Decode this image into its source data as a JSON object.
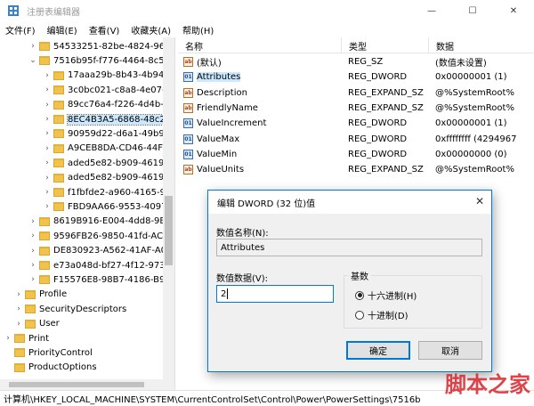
{
  "window": {
    "title": "注册表编辑器",
    "controls": [
      "—",
      "☐",
      "✕"
    ]
  },
  "menu": [
    "文件(F)",
    "编辑(E)",
    "查看(V)",
    "收藏夹(A)",
    "帮助(H)"
  ],
  "tree": [
    {
      "label": "54533251-82be-4824-96c",
      "indent": 32,
      "chevron": "›"
    },
    {
      "label": "7516b95f-f776-4464-8c53",
      "indent": 32,
      "chevron": "⌄"
    },
    {
      "label": "17aaa29b-8b43-4b94",
      "indent": 48,
      "chevron": "›"
    },
    {
      "label": "3c0bc021-c8a8-4e07-a",
      "indent": 48,
      "chevron": "›"
    },
    {
      "label": "89cc76a4-f226-4d4b-a",
      "indent": 48,
      "chevron": "›"
    },
    {
      "label": "8EC4B3A5-6868-48c2-",
      "indent": 48,
      "chevron": "›",
      "selected": true
    },
    {
      "label": "90959d22-d6a1-49b9-",
      "indent": 48,
      "chevron": "›"
    },
    {
      "label": "A9CEB8DA-CD46-44FE",
      "indent": 48,
      "chevron": "›"
    },
    {
      "label": "aded5e82-b909-4619-",
      "indent": 48,
      "chevron": "›"
    },
    {
      "label": "aded5e82-b909-4619-",
      "indent": 48,
      "chevron": "›"
    },
    {
      "label": "f1fbfde2-a960-4165-9",
      "indent": 48,
      "chevron": "›"
    },
    {
      "label": "FBD9AA66-9553-4097",
      "indent": 48,
      "chevron": "›"
    },
    {
      "label": "8619B916-E004-4dd8-9B",
      "indent": 32,
      "chevron": "›"
    },
    {
      "label": "9596FB26-9850-41fd-AC3",
      "indent": 32,
      "chevron": "›"
    },
    {
      "label": "DE830923-A562-41AF-A0",
      "indent": 32,
      "chevron": "›"
    },
    {
      "label": "e73a048d-bf27-4f12-973",
      "indent": 32,
      "chevron": "›"
    },
    {
      "label": "F15576E8-98B7-4186-B94",
      "indent": 32,
      "chevron": "›"
    },
    {
      "label": "Profile",
      "indent": 16,
      "chevron": "›"
    },
    {
      "label": "SecurityDescriptors",
      "indent": 16,
      "chevron": "›"
    },
    {
      "label": "User",
      "indent": 16,
      "chevron": "›"
    },
    {
      "label": "Print",
      "indent": 4,
      "chevron": "›"
    },
    {
      "label": "PriorityControl",
      "indent": 4,
      "chevron": ""
    },
    {
      "label": "ProductOptions",
      "indent": 4,
      "chevron": ""
    }
  ],
  "list": {
    "headers": [
      "名称",
      "类型",
      "数据"
    ],
    "rows": [
      {
        "name": "(默认)",
        "type": "REG_SZ",
        "data": "(数值未设置)",
        "icon": "sz"
      },
      {
        "name": "Attributes",
        "type": "REG_DWORD",
        "data": "0x00000001 (1)",
        "icon": "dword",
        "selected": true
      },
      {
        "name": "Description",
        "type": "REG_EXPAND_SZ",
        "data": "@%SystemRoot%",
        "icon": "sz"
      },
      {
        "name": "FriendlyName",
        "type": "REG_EXPAND_SZ",
        "data": "@%SystemRoot%",
        "icon": "sz"
      },
      {
        "name": "ValueIncrement",
        "type": "REG_DWORD",
        "data": "0x00000001 (1)",
        "icon": "dword"
      },
      {
        "name": "ValueMax",
        "type": "REG_DWORD",
        "data": "0xffffffff (4294967",
        "icon": "dword"
      },
      {
        "name": "ValueMin",
        "type": "REG_DWORD",
        "data": "0x00000000 (0)",
        "icon": "dword"
      },
      {
        "name": "ValueUnits",
        "type": "REG_EXPAND_SZ",
        "data": "@%SystemRoot%",
        "icon": "sz"
      }
    ]
  },
  "statusbar": "计算机\\HKEY_LOCAL_MACHINE\\SYSTEM\\CurrentControlSet\\Control\\Power\\PowerSettings\\7516b",
  "dialog": {
    "title": "编辑 DWORD (32 位)值",
    "value_name_label": "数值名称(N):",
    "value_name": "Attributes",
    "value_data_label": "数值数据(V):",
    "value_data": "2",
    "base_label": "基数",
    "hex_label": "十六进制(H)",
    "dec_label": "十进制(D)",
    "hex_selected": true,
    "ok_label": "确定",
    "cancel_label": "取消"
  },
  "watermark": "脚本之家"
}
